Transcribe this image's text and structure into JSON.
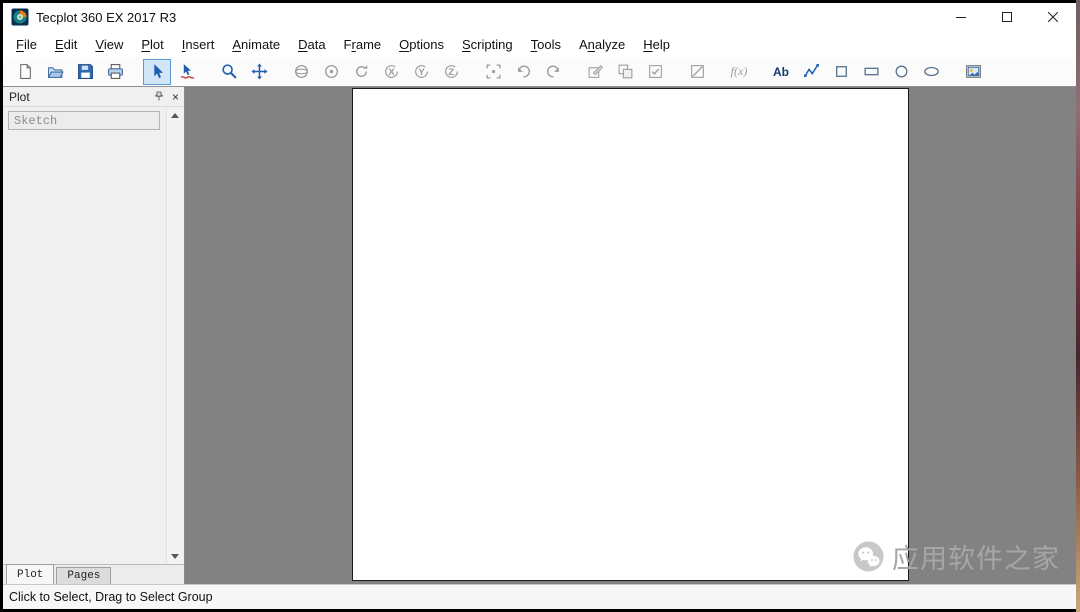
{
  "window": {
    "title": "Tecplot 360 EX 2017 R3",
    "controls": [
      "minimize",
      "maximize",
      "close"
    ]
  },
  "menu": {
    "items": [
      {
        "label": "File",
        "u": 0
      },
      {
        "label": "Edit",
        "u": 0
      },
      {
        "label": "View",
        "u": 0
      },
      {
        "label": "Plot",
        "u": 0
      },
      {
        "label": "Insert",
        "u": 0
      },
      {
        "label": "Animate",
        "u": 0
      },
      {
        "label": "Data",
        "u": 0
      },
      {
        "label": "Frame",
        "u": 1
      },
      {
        "label": "Options",
        "u": 0
      },
      {
        "label": "Scripting",
        "u": 0
      },
      {
        "label": "Tools",
        "u": 0
      },
      {
        "label": "Analyze",
        "u": 1
      },
      {
        "label": "Help",
        "u": 0
      }
    ]
  },
  "toolbar": {
    "text_label": "Ab",
    "fx_label": "f(x)",
    "axis": {
      "x": "X",
      "y": "Y",
      "z": "Z"
    },
    "buttons": [
      {
        "name": "new-layout",
        "enabled": true
      },
      {
        "name": "open",
        "enabled": true
      },
      {
        "name": "save",
        "enabled": true
      },
      {
        "name": "print",
        "enabled": true
      },
      {
        "name": "select",
        "enabled": true,
        "active": true
      },
      {
        "name": "adjust",
        "enabled": true
      },
      {
        "name": "zoom",
        "enabled": true
      },
      {
        "name": "translate",
        "enabled": true
      },
      {
        "name": "rotate-spherical",
        "enabled": false
      },
      {
        "name": "rotate-rollerball",
        "enabled": false
      },
      {
        "name": "rotate-twist",
        "enabled": false
      },
      {
        "name": "rotate-x",
        "enabled": false
      },
      {
        "name": "rotate-y",
        "enabled": false
      },
      {
        "name": "rotate-z",
        "enabled": false
      },
      {
        "name": "fit-view",
        "enabled": false
      },
      {
        "name": "undo-view",
        "enabled": false
      },
      {
        "name": "redo-view",
        "enabled": false
      },
      {
        "name": "redraw",
        "enabled": false
      },
      {
        "name": "redraw-all",
        "enabled": false
      },
      {
        "name": "auto-redraw",
        "enabled": false
      },
      {
        "name": "extended-redraw",
        "enabled": false
      },
      {
        "name": "function-tool",
        "enabled": false
      },
      {
        "name": "text-tool",
        "enabled": true
      },
      {
        "name": "polyline-tool",
        "enabled": true
      },
      {
        "name": "square-tool",
        "enabled": true
      },
      {
        "name": "rectangle-tool",
        "enabled": true
      },
      {
        "name": "circle-tool",
        "enabled": true
      },
      {
        "name": "ellipse-tool",
        "enabled": true
      },
      {
        "name": "create-frame",
        "enabled": true
      }
    ]
  },
  "sidebar": {
    "panel_title": "Plot",
    "mode_dropdown_value": "Sketch",
    "tabs": [
      {
        "label": "Plot",
        "active": true
      },
      {
        "label": "Pages",
        "active": false
      }
    ]
  },
  "statusbar": {
    "message": "Click to Select, Drag to Select Group"
  },
  "watermark": {
    "text": "应用软件之家"
  },
  "colors": {
    "accent_blue": "#1d5fb0",
    "disabled_gray": "#9a9aa0",
    "workspace_gray": "#828282",
    "active_button_bg": "#d2e6f8",
    "active_button_border": "#5b9bd5"
  }
}
